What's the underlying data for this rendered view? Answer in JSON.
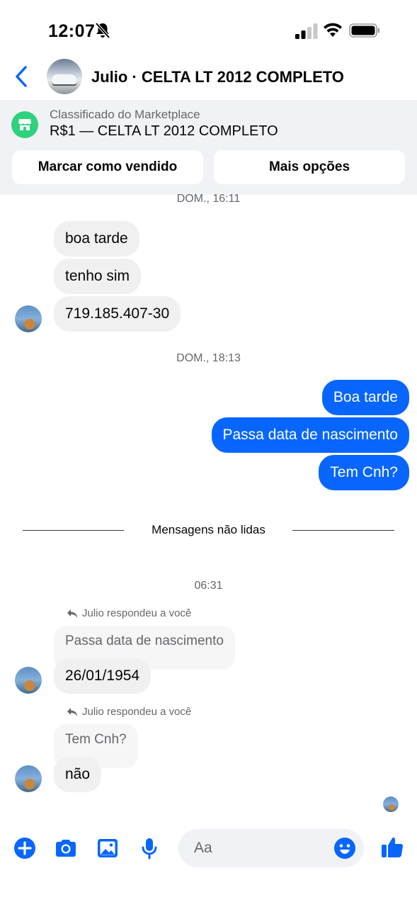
{
  "status_bar": {
    "time": "12:07"
  },
  "header": {
    "title": "Julio · CELTA LT 2012 COMPLETO"
  },
  "marketplace": {
    "label": "Classificado do Marketplace",
    "item": "R$1 — CELTA LT 2012 COMPLETO",
    "mark_sold_label": "Marcar como vendido",
    "more_options_label": "Mais opções"
  },
  "messages": {
    "ts1": "DOM., 16:11",
    "in1": "boa tarde",
    "in2": "tenho sim",
    "in3": "719.185.407-30",
    "ts2": "DOM., 18:13",
    "out1": "Boa tarde",
    "out2": "Passa data de nascimento",
    "out3": "Tem Cnh?",
    "unread_label": "Mensagens não lidas",
    "ts3": "06:31",
    "reply_note_1": "Julio respondeu a você",
    "quote_1": "Passa data de nascimento",
    "in4": "26/01/1954",
    "reply_note_2": "Julio respondeu a você",
    "quote_2": "Tem Cnh?",
    "in5": "não"
  },
  "composer": {
    "placeholder": "Aa"
  },
  "colors": {
    "accent": "#0866ff",
    "marketplace": "#2fd17c",
    "incoming_bubble": "#f0f0f0"
  }
}
